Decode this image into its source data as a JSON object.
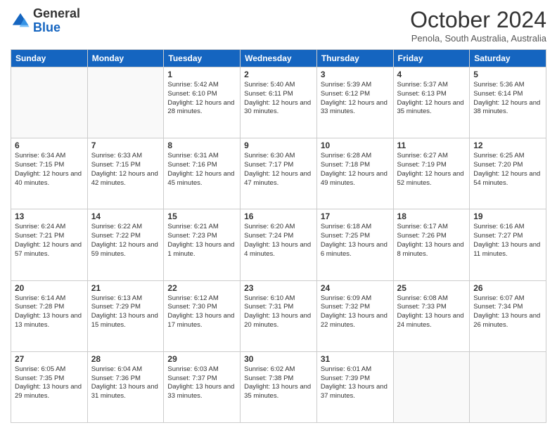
{
  "header": {
    "logo_general": "General",
    "logo_blue": "Blue",
    "month_title": "October 2024",
    "subtitle": "Penola, South Australia, Australia"
  },
  "days_of_week": [
    "Sunday",
    "Monday",
    "Tuesday",
    "Wednesday",
    "Thursday",
    "Friday",
    "Saturday"
  ],
  "weeks": [
    [
      {
        "day": "",
        "detail": ""
      },
      {
        "day": "",
        "detail": ""
      },
      {
        "day": "1",
        "detail": "Sunrise: 5:42 AM\nSunset: 6:10 PM\nDaylight: 12 hours and 28 minutes."
      },
      {
        "day": "2",
        "detail": "Sunrise: 5:40 AM\nSunset: 6:11 PM\nDaylight: 12 hours and 30 minutes."
      },
      {
        "day": "3",
        "detail": "Sunrise: 5:39 AM\nSunset: 6:12 PM\nDaylight: 12 hours and 33 minutes."
      },
      {
        "day": "4",
        "detail": "Sunrise: 5:37 AM\nSunset: 6:13 PM\nDaylight: 12 hours and 35 minutes."
      },
      {
        "day": "5",
        "detail": "Sunrise: 5:36 AM\nSunset: 6:14 PM\nDaylight: 12 hours and 38 minutes."
      }
    ],
    [
      {
        "day": "6",
        "detail": "Sunrise: 6:34 AM\nSunset: 7:15 PM\nDaylight: 12 hours and 40 minutes."
      },
      {
        "day": "7",
        "detail": "Sunrise: 6:33 AM\nSunset: 7:15 PM\nDaylight: 12 hours and 42 minutes."
      },
      {
        "day": "8",
        "detail": "Sunrise: 6:31 AM\nSunset: 7:16 PM\nDaylight: 12 hours and 45 minutes."
      },
      {
        "day": "9",
        "detail": "Sunrise: 6:30 AM\nSunset: 7:17 PM\nDaylight: 12 hours and 47 minutes."
      },
      {
        "day": "10",
        "detail": "Sunrise: 6:28 AM\nSunset: 7:18 PM\nDaylight: 12 hours and 49 minutes."
      },
      {
        "day": "11",
        "detail": "Sunrise: 6:27 AM\nSunset: 7:19 PM\nDaylight: 12 hours and 52 minutes."
      },
      {
        "day": "12",
        "detail": "Sunrise: 6:25 AM\nSunset: 7:20 PM\nDaylight: 12 hours and 54 minutes."
      }
    ],
    [
      {
        "day": "13",
        "detail": "Sunrise: 6:24 AM\nSunset: 7:21 PM\nDaylight: 12 hours and 57 minutes."
      },
      {
        "day": "14",
        "detail": "Sunrise: 6:22 AM\nSunset: 7:22 PM\nDaylight: 12 hours and 59 minutes."
      },
      {
        "day": "15",
        "detail": "Sunrise: 6:21 AM\nSunset: 7:23 PM\nDaylight: 13 hours and 1 minute."
      },
      {
        "day": "16",
        "detail": "Sunrise: 6:20 AM\nSunset: 7:24 PM\nDaylight: 13 hours and 4 minutes."
      },
      {
        "day": "17",
        "detail": "Sunrise: 6:18 AM\nSunset: 7:25 PM\nDaylight: 13 hours and 6 minutes."
      },
      {
        "day": "18",
        "detail": "Sunrise: 6:17 AM\nSunset: 7:26 PM\nDaylight: 13 hours and 8 minutes."
      },
      {
        "day": "19",
        "detail": "Sunrise: 6:16 AM\nSunset: 7:27 PM\nDaylight: 13 hours and 11 minutes."
      }
    ],
    [
      {
        "day": "20",
        "detail": "Sunrise: 6:14 AM\nSunset: 7:28 PM\nDaylight: 13 hours and 13 minutes."
      },
      {
        "day": "21",
        "detail": "Sunrise: 6:13 AM\nSunset: 7:29 PM\nDaylight: 13 hours and 15 minutes."
      },
      {
        "day": "22",
        "detail": "Sunrise: 6:12 AM\nSunset: 7:30 PM\nDaylight: 13 hours and 17 minutes."
      },
      {
        "day": "23",
        "detail": "Sunrise: 6:10 AM\nSunset: 7:31 PM\nDaylight: 13 hours and 20 minutes."
      },
      {
        "day": "24",
        "detail": "Sunrise: 6:09 AM\nSunset: 7:32 PM\nDaylight: 13 hours and 22 minutes."
      },
      {
        "day": "25",
        "detail": "Sunrise: 6:08 AM\nSunset: 7:33 PM\nDaylight: 13 hours and 24 minutes."
      },
      {
        "day": "26",
        "detail": "Sunrise: 6:07 AM\nSunset: 7:34 PM\nDaylight: 13 hours and 26 minutes."
      }
    ],
    [
      {
        "day": "27",
        "detail": "Sunrise: 6:05 AM\nSunset: 7:35 PM\nDaylight: 13 hours and 29 minutes."
      },
      {
        "day": "28",
        "detail": "Sunrise: 6:04 AM\nSunset: 7:36 PM\nDaylight: 13 hours and 31 minutes."
      },
      {
        "day": "29",
        "detail": "Sunrise: 6:03 AM\nSunset: 7:37 PM\nDaylight: 13 hours and 33 minutes."
      },
      {
        "day": "30",
        "detail": "Sunrise: 6:02 AM\nSunset: 7:38 PM\nDaylight: 13 hours and 35 minutes."
      },
      {
        "day": "31",
        "detail": "Sunrise: 6:01 AM\nSunset: 7:39 PM\nDaylight: 13 hours and 37 minutes."
      },
      {
        "day": "",
        "detail": ""
      },
      {
        "day": "",
        "detail": ""
      }
    ]
  ]
}
